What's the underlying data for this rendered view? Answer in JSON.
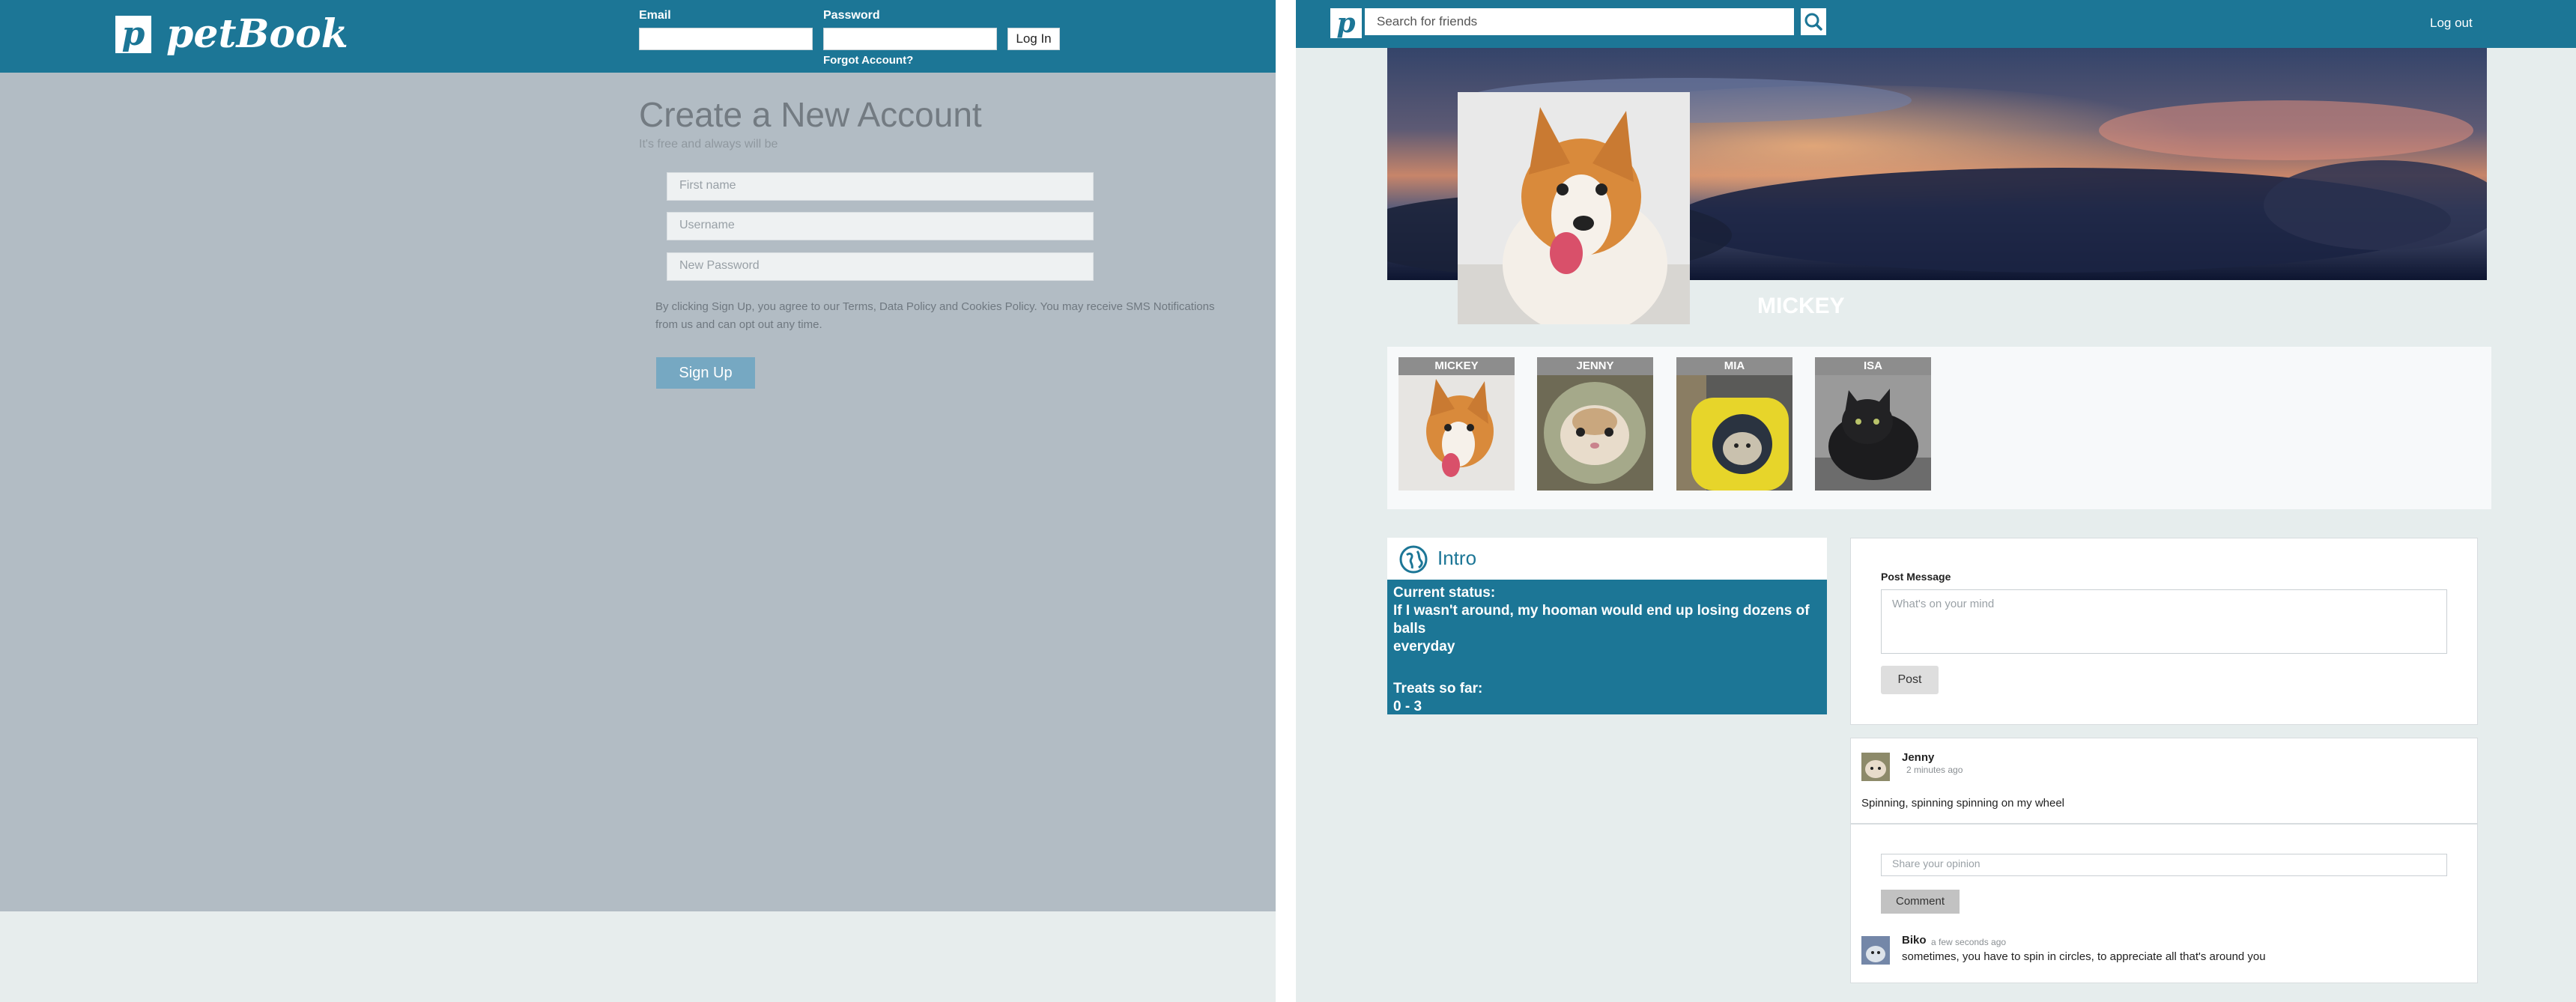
{
  "login_page": {
    "brand": "petBook",
    "logo_letter": "p",
    "email_label": "Email",
    "password_label": "Password",
    "login_button": "Log In",
    "forgot_link": "Forgot Account?",
    "title": "Create a New Account",
    "subtitle": "It's free and always will be",
    "first_name_placeholder": "First name",
    "username_placeholder": "Username",
    "new_password_placeholder": "New Password",
    "terms_line1": "By clicking Sign Up, you agree to our Terms, Data Policy and Cookies Policy. You may receive SMS Notifications",
    "terms_line2": "from us and can opt out any time.",
    "signup_button": "Sign Up"
  },
  "profile_page": {
    "logo_letter": "p",
    "search_placeholder": "Search for friends",
    "search_icon": "search-icon",
    "logout": "Log out",
    "profile_name": "MICKEY",
    "friends": [
      {
        "name": "MICKEY"
      },
      {
        "name": "JENNY"
      },
      {
        "name": "MIA"
      },
      {
        "name": "ISA"
      }
    ],
    "intro": {
      "title": "Intro",
      "icon": "globe-icon",
      "status_label": "Current status:",
      "status_line1": "If I wasn't around, my hooman would end up losing dozens of balls",
      "status_line2": "everyday",
      "treats_label": "Treats so far:",
      "treats_value": "0 - 3"
    },
    "post_form": {
      "label": "Post Message",
      "placeholder": "What's on your mind",
      "button": "Post"
    },
    "post": {
      "author": "Jenny",
      "time": "2 minutes ago",
      "text": "Spinning, spinning spinning on my wheel",
      "comment_placeholder": "Share your opinion",
      "comment_button": "Comment",
      "comment": {
        "author": "Biko",
        "time": "a few seconds ago",
        "text": "sometimes, you have to spin in circles, to appreciate all that's around you"
      }
    },
    "colors": {
      "brand": "#1c7696",
      "background": "#e6eded"
    }
  }
}
